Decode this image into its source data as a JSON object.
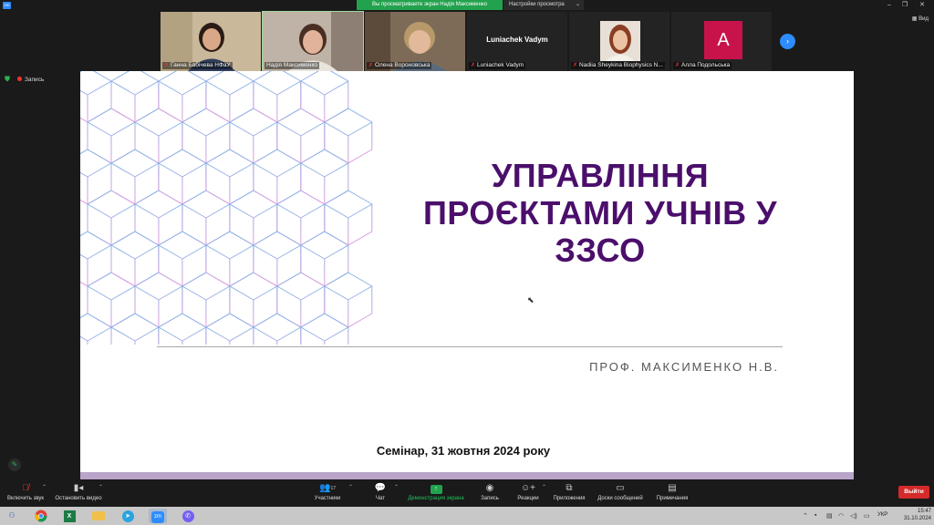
{
  "window": {
    "share_banner": "Вы просматриваете экран Надія Максименко",
    "view_settings": "Настройки просмотра",
    "view_toggle": "Вид"
  },
  "participants": [
    {
      "name": "Ганна Бабічева НФаУ",
      "muted": true
    },
    {
      "name": "Надія Максименко",
      "muted": false,
      "active": true
    },
    {
      "name": "Олена Вороновська",
      "muted": true
    },
    {
      "name": "Luniachek Vadym",
      "muted": true,
      "big_name": "Luniachek Vadym"
    },
    {
      "name": "Nadiia Sheykina Biophysics N...",
      "muted": true
    },
    {
      "name": "Алла Подольська",
      "muted": true,
      "avatar_letter": "A",
      "avatar_color": "#c8134a"
    }
  ],
  "recording": {
    "label": "Запись"
  },
  "slide": {
    "title": "УПРАВЛІННЯ ПРОЄКТАМИ УЧНІВ У ЗЗСО",
    "author": "ПРОФ. МАКСИМЕНКО Н.В.",
    "footer": "Семінар, 31 жовтня 2024 року",
    "title_color": "#4b0f6b"
  },
  "toolbar": {
    "audio": "Включить звук",
    "video": "Остановить видео",
    "participants": "Участники",
    "participants_count": "17",
    "chat": "Чат",
    "share": "Демонстрация экрана",
    "record": "Запись",
    "reactions": "Реакции",
    "apps": "Приложения",
    "whiteboard": "Доски сообщений",
    "notes": "Примечания",
    "leave": "Выйти"
  },
  "taskbar": {
    "lang": "УКР",
    "time": "15:47",
    "date": "31.10.2024"
  }
}
